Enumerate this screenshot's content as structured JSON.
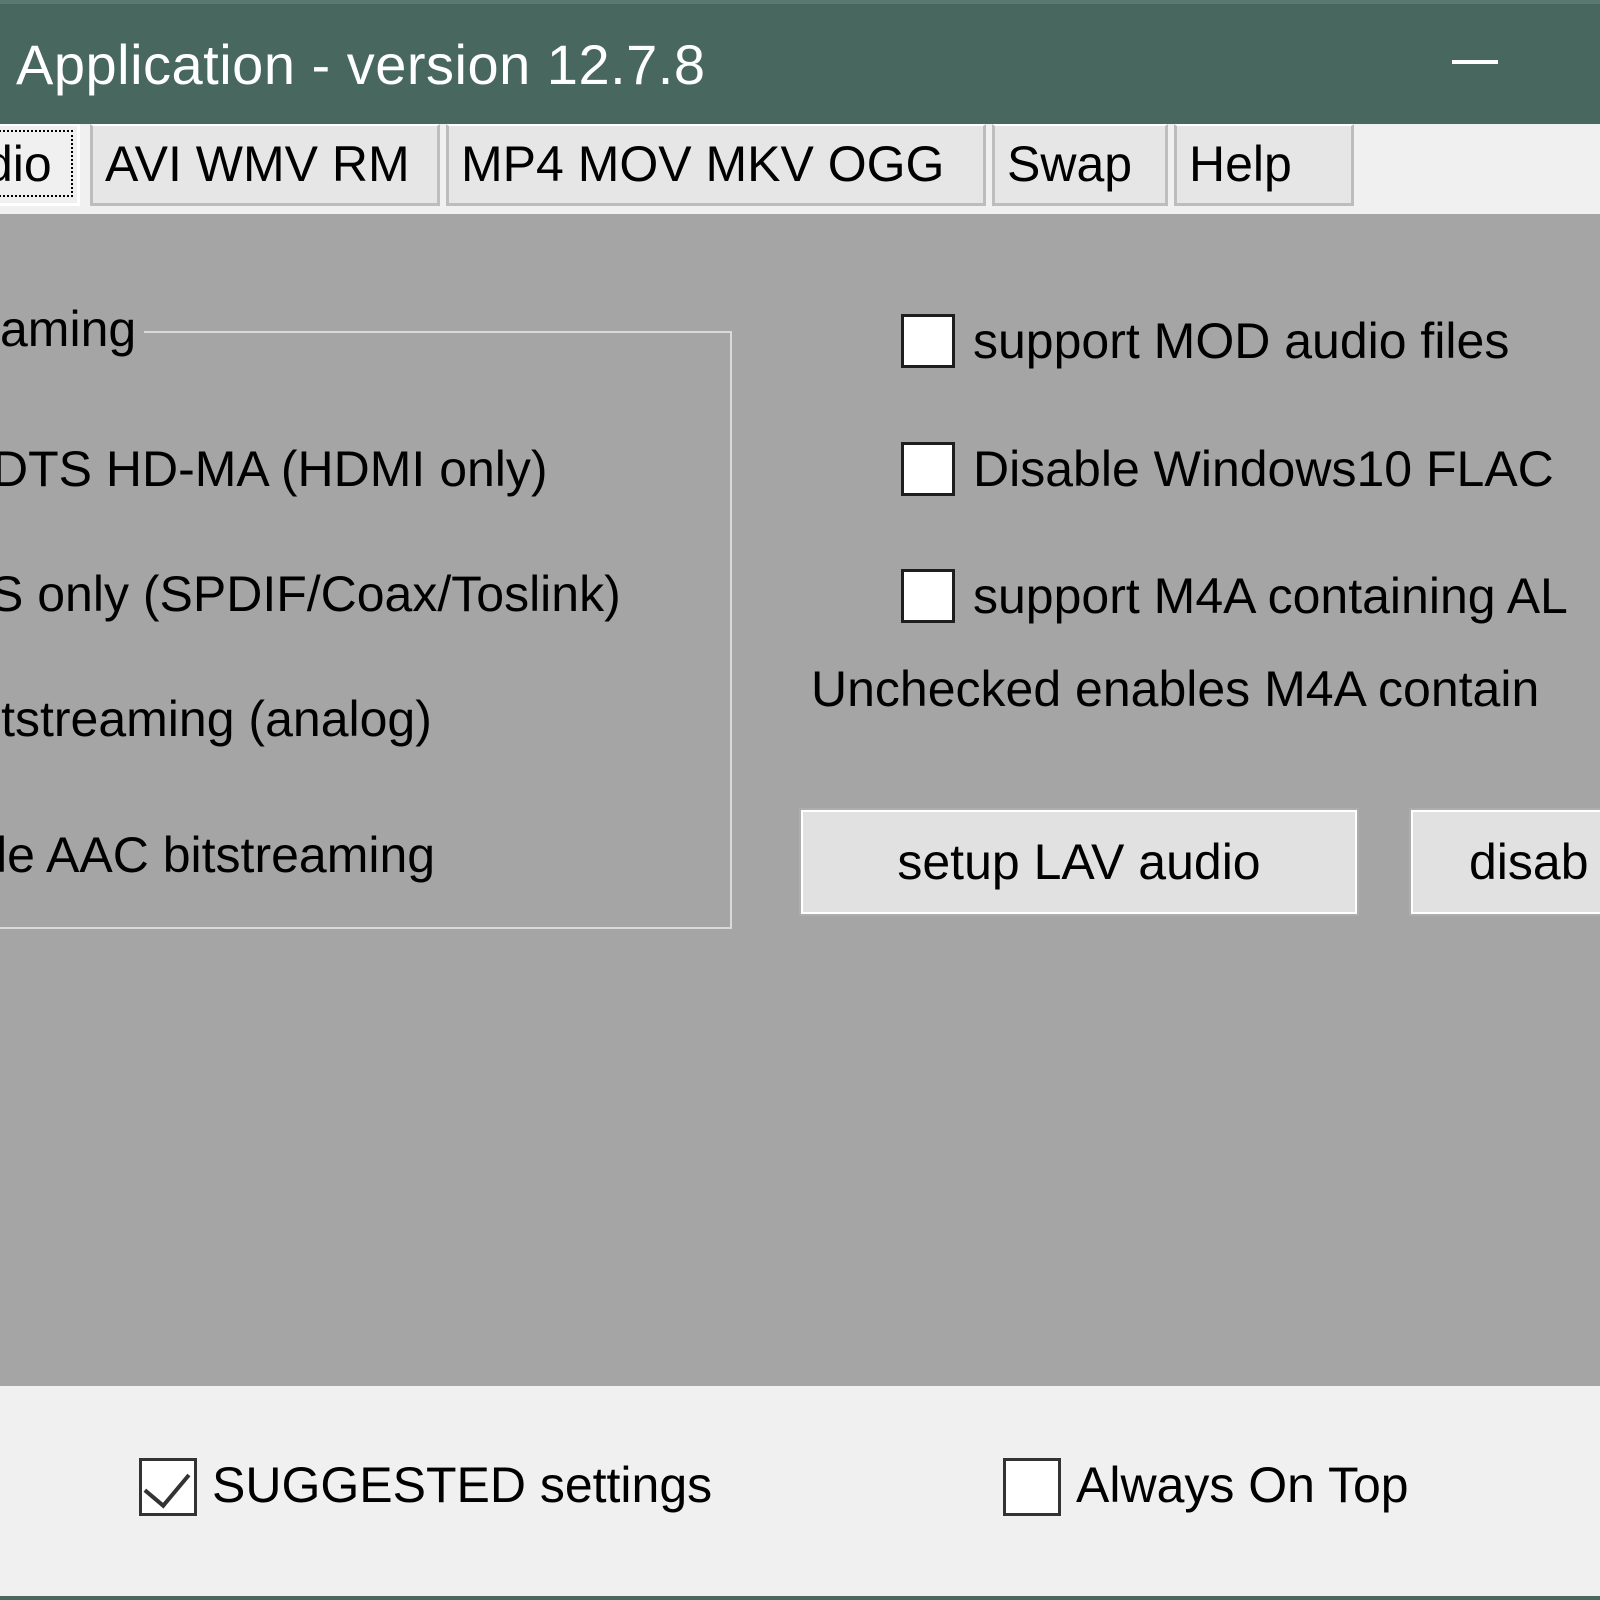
{
  "window": {
    "title": "Application - version 12.7.8",
    "minimize_icon": "minimize-icon",
    "titlebar_color": "#48685f"
  },
  "tabs": [
    {
      "label": "dio",
      "active": true
    },
    {
      "label": "AVI WMV RM",
      "active": false
    },
    {
      "label": "MP4 MOV MKV OGG",
      "active": false
    },
    {
      "label": "Swap",
      "active": false
    },
    {
      "label": "Help",
      "active": false
    }
  ],
  "bitstream_group": {
    "label": "aming",
    "options": [
      "DTS HD-MA (HDMI only)",
      "S only (SPDIF/Coax/Toslink)",
      "itstreaming (analog)",
      "le AAC bitstreaming"
    ]
  },
  "options": {
    "mod_audio": {
      "label": "support MOD audio files",
      "checked": false
    },
    "win10_flac": {
      "label": "Disable Windows10 FLAC",
      "checked": false
    },
    "m4a_alac": {
      "label": "support M4A containing AL",
      "checked": false
    },
    "note": "Unchecked enables M4A contain"
  },
  "buttons": {
    "setup_lav": "setup LAV audio",
    "disable": "disab"
  },
  "footer": {
    "suggested": {
      "label": "SUGGESTED settings",
      "checked": true
    },
    "always_on_top": {
      "label": "Always On Top",
      "checked": false
    }
  }
}
